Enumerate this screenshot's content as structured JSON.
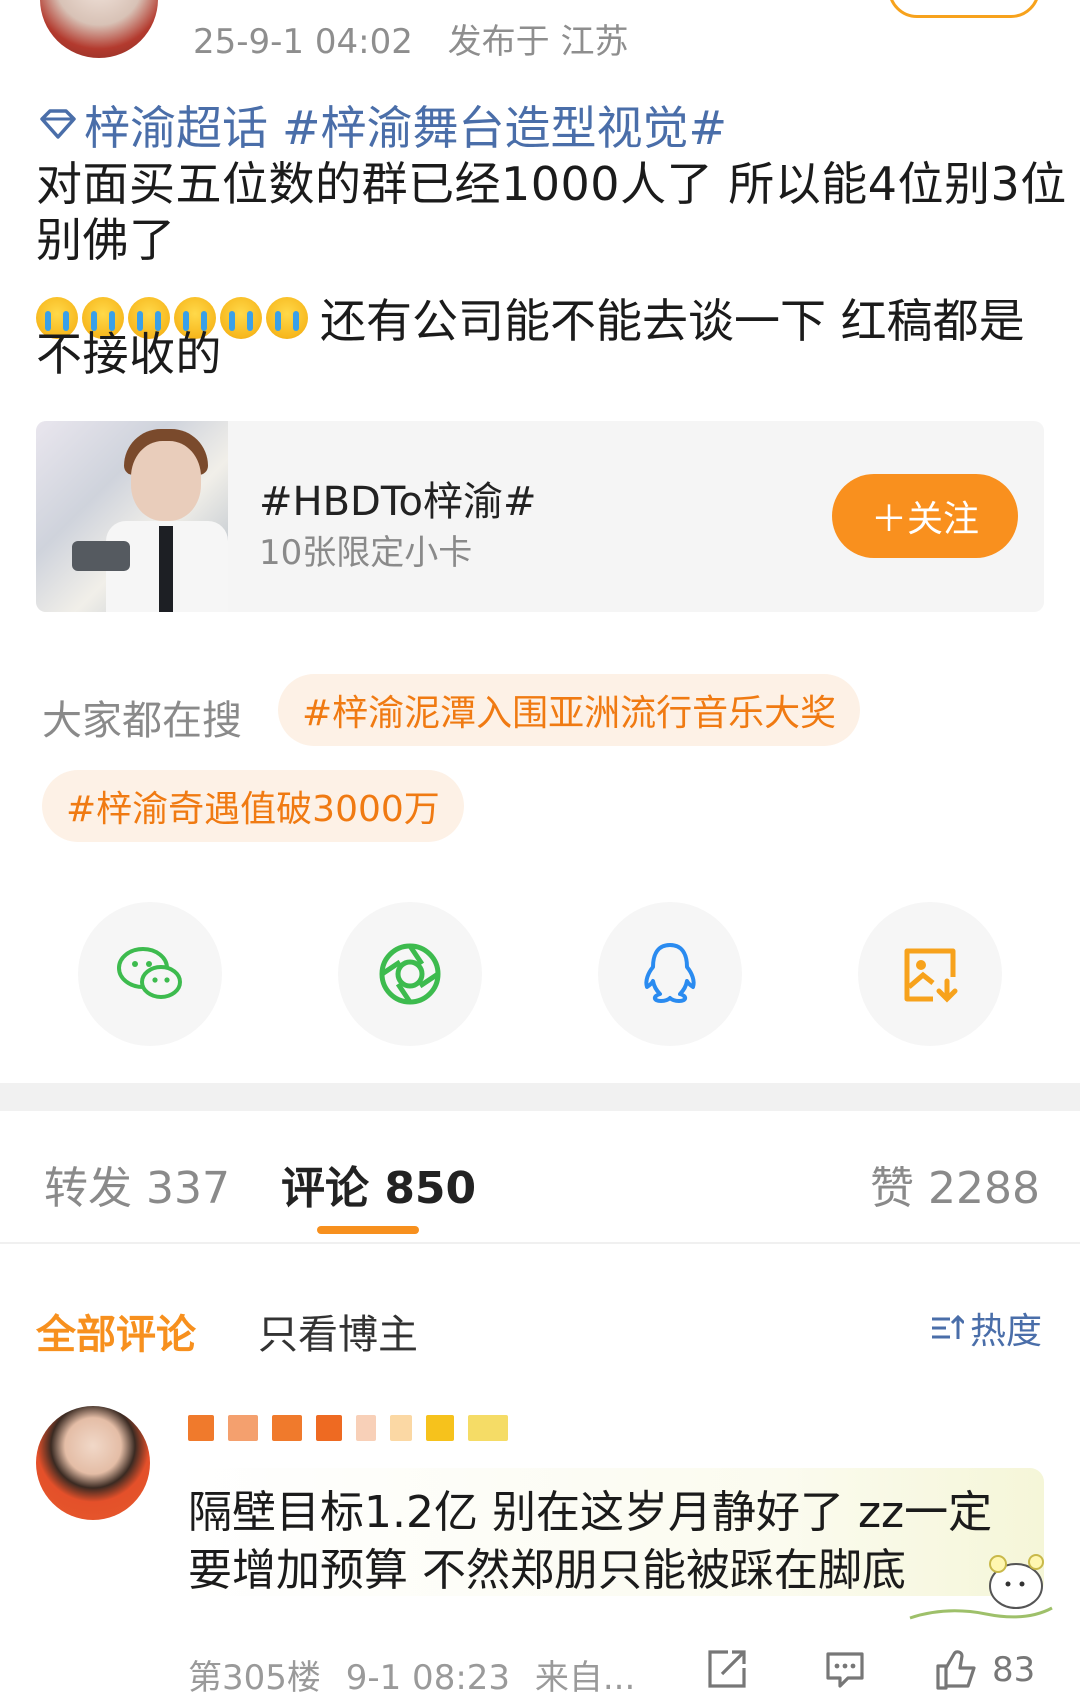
{
  "header": {
    "timestamp": "25-9-1 04:02",
    "location": "发布于 江苏"
  },
  "post": {
    "super_topic": "梓渝超话",
    "topic_tag": "#梓渝舞台造型视觉#",
    "line1": "对面买五位数的群已经1000人了 所以能4位别3位",
    "line2": "别佛了",
    "emoji_name": "crying-face-icon",
    "emoji_count": 6,
    "line3": "还有公司能不能去谈一下 红稿都是",
    "line4": "不接收的"
  },
  "card": {
    "title": "#HBDTo梓渝#",
    "subtitle": "10张限定小卡",
    "follow_label": "＋关注"
  },
  "trending": {
    "label": "大家都在搜",
    "tags": [
      "#梓渝泥潭入围亚洲流行音乐大奖",
      "#梓渝奇遇值破3000万"
    ]
  },
  "share": [
    "wechat-icon",
    "moments-icon",
    "qq-icon",
    "save-image-icon"
  ],
  "stats": {
    "repost": "转发 337",
    "comment": "评论 850",
    "like": "赞 2288"
  },
  "filters": {
    "all": "全部评论",
    "blogger": "只看博主",
    "sort": "热度"
  },
  "comment": {
    "line1": "隔壁目标1.2亿 别在这岁月静好了 zz一定",
    "line2": "要增加预算 不然郑朋只能被踩在脚底",
    "floor": "第305楼",
    "time": "9-1 08:23",
    "source": "来自...",
    "like_count": "83"
  },
  "colors": {
    "accent": "#f7901e",
    "link": "#4a6ea9",
    "muted": "#8a8a8a"
  }
}
